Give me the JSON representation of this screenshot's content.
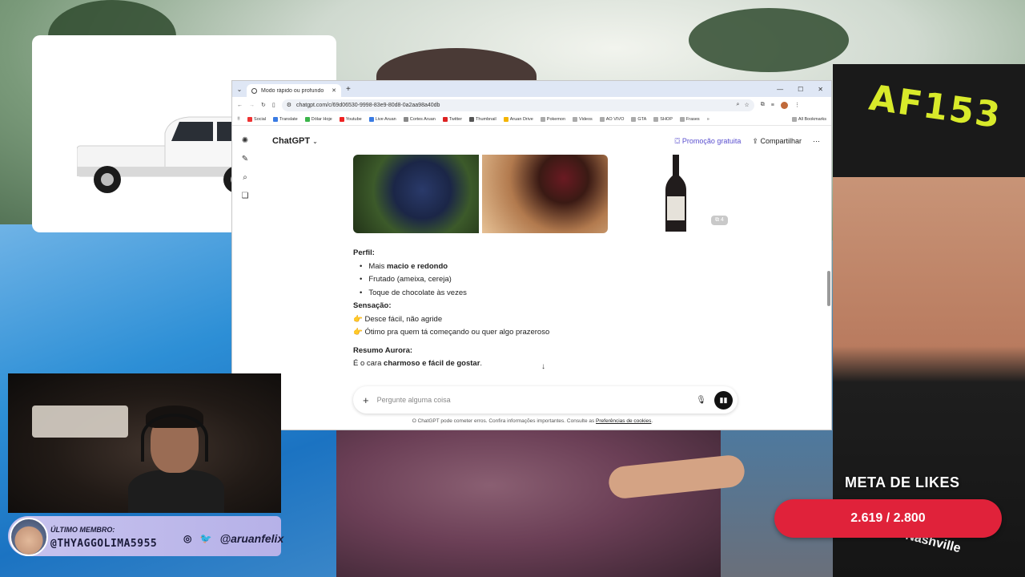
{
  "browser": {
    "tab_title": "Modo rápido ou profundo",
    "url": "chatgpt.com/c/69d06530-9998-83e9-80d8-0a2aa98a40db",
    "bookmarks": [
      "Social",
      "Translate",
      "Dólar Hoje",
      "Youtube",
      "Live Aruan",
      "Cortes Aruan",
      "Twitter",
      "Thumbnail",
      "Aruan Drive",
      "Pokemon",
      "Videos",
      "AO VIVO",
      "GTA",
      "SHOP",
      "Frases"
    ],
    "bookmarks_overflow": "»",
    "all_bookmarks": "All Bookmarks"
  },
  "chat": {
    "app_name": "ChatGPT",
    "promo": "Promoção gratuita",
    "share": "Compartilhar",
    "more_images_count": "4",
    "profile_heading": "Perfil:",
    "profile_item1_prefix": "Mais ",
    "profile_item1_bold": "macio e redondo",
    "profile_item2": "Frutado (ameixa, cereja)",
    "profile_item3": "Toque de chocolate às vezes",
    "sensation_heading": "Sensação:",
    "sensation_item1": "Desce fácil, não agride",
    "sensation_item2": "Ótimo pra quem tá começando ou quer algo prazeroso",
    "summary_heading": "Resumo Aurora:",
    "summary_prefix": "É o cara ",
    "summary_bold": "charmoso e fácil de gostar",
    "summary_suffix": ".",
    "composer_placeholder": "Pergunte alguma coisa",
    "disclaimer_text": "O ChatGPT pode cometer erros. Confira informações importantes. Consulte as ",
    "disclaimer_link": "Preferências de cookies",
    "disclaimer_end": "."
  },
  "overlay": {
    "member_label": "ÚLTIMO MEMBRO:",
    "member_name": "@THYAGGOLIMA5955",
    "social_handle": "@aruanfelix",
    "likes_title": "META DE LIKES",
    "likes_value": "2.619 / 2.800",
    "cap_text": "AF153",
    "shirt_text": "Nashville"
  },
  "colors": {
    "likes_bar": "#e0223a",
    "promo": "#5a4fcf",
    "member_bar": "#c7c3ee"
  }
}
